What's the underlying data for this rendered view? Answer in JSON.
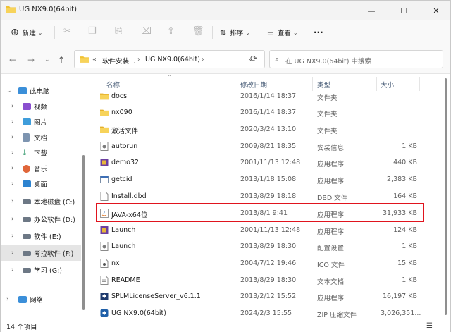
{
  "window": {
    "title": "UG NX9.0(64bit)",
    "controls": {
      "minimize": "—",
      "maximize": "☐",
      "close": "✕"
    }
  },
  "toolbar": {
    "new_label": "新建",
    "sort_label": "排序",
    "view_label": "查看",
    "more_label": "···"
  },
  "address": {
    "root_glyph": "«",
    "crumb1": "软件安装...",
    "crumb2": "UG NX9.0(64bit)",
    "sep": "›"
  },
  "search": {
    "placeholder": "在 UG NX9.0(64bit) 中搜索"
  },
  "sidebar": {
    "items": [
      {
        "label": "此电脑",
        "icon": "pc-icon"
      },
      {
        "label": "视频",
        "icon": "video-icon"
      },
      {
        "label": "图片",
        "icon": "picture-icon"
      },
      {
        "label": "文档",
        "icon": "document-icon"
      },
      {
        "label": "下载",
        "icon": "download-icon"
      },
      {
        "label": "音乐",
        "icon": "music-icon"
      },
      {
        "label": "桌面",
        "icon": "desktop-icon"
      },
      {
        "label": "本地磁盘 (C:)",
        "icon": "drive-icon"
      },
      {
        "label": "办公软件 (D:)",
        "icon": "drive-icon"
      },
      {
        "label": "软件 (E:)",
        "icon": "drive-icon"
      },
      {
        "label": "考拉软件 (F:)",
        "icon": "drive-icon"
      },
      {
        "label": "学习 (G:)",
        "icon": "drive-icon"
      },
      {
        "label": "网络",
        "icon": "network-icon"
      }
    ]
  },
  "columns": {
    "name": "名称",
    "date": "修改日期",
    "type": "类型",
    "size": "大小"
  },
  "files": [
    {
      "name": "docs",
      "date": "2016/1/14 18:37",
      "type": "文件夹",
      "size": "",
      "icon": "folder-icon"
    },
    {
      "name": "nx090",
      "date": "2016/1/14 18:37",
      "type": "文件夹",
      "size": "",
      "icon": "folder-icon"
    },
    {
      "name": "激活文件",
      "date": "2020/3/24 13:10",
      "type": "文件夹",
      "size": "",
      "icon": "folder-icon"
    },
    {
      "name": "autorun",
      "date": "2009/8/21 18:35",
      "type": "安装信息",
      "size": "1 KB",
      "icon": "settings-file-icon"
    },
    {
      "name": "demo32",
      "date": "2001/11/13 12:48",
      "type": "应用程序",
      "size": "440 KB",
      "icon": "app-icon"
    },
    {
      "name": "getcid",
      "date": "2013/1/18 15:08",
      "type": "应用程序",
      "size": "2,383 KB",
      "icon": "app-icon"
    },
    {
      "name": "Install.dbd",
      "date": "2013/8/29 18:18",
      "type": "DBD 文件",
      "size": "164 KB",
      "icon": "file-icon"
    },
    {
      "name": "JAVA-x64位",
      "date": "2013/8/1 9:41",
      "type": "应用程序",
      "size": "31,933 KB",
      "icon": "java-icon"
    },
    {
      "name": "Launch",
      "date": "2001/11/13 12:48",
      "type": "应用程序",
      "size": "124 KB",
      "icon": "app-icon"
    },
    {
      "name": "Launch",
      "date": "2013/8/29 18:30",
      "type": "配置设置",
      "size": "1 KB",
      "icon": "settings-file-icon"
    },
    {
      "name": "nx",
      "date": "2004/7/12 19:46",
      "type": "ICO 文件",
      "size": "15 KB",
      "icon": "ico-icon"
    },
    {
      "name": "README",
      "date": "2013/8/29 18:30",
      "type": "文本文档",
      "size": "1 KB",
      "icon": "text-icon"
    },
    {
      "name": "SPLMLicenseServer_v6.1.1",
      "date": "2013/2/12 15:52",
      "type": "应用程序",
      "size": "16,197 KB",
      "icon": "app-icon"
    },
    {
      "name": "UG NX9.0(64bit)",
      "date": "2024/2/3 15:55",
      "type": "ZIP 压缩文件",
      "size": "3,026,351...",
      "icon": "zip-icon"
    }
  ],
  "status": {
    "count": "14 个项目"
  },
  "colors": {
    "folder": "#f1c232",
    "highlight": "#e0141e",
    "selection": "#e5e5e5"
  }
}
